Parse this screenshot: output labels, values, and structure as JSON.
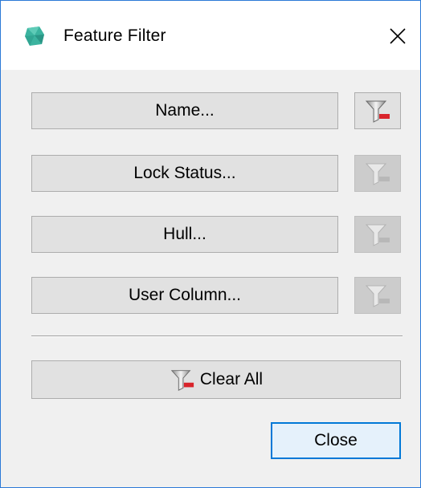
{
  "window": {
    "title": "Feature Filter"
  },
  "filters": [
    {
      "label": "Name...",
      "clear_enabled": true
    },
    {
      "label": "Lock Status...",
      "clear_enabled": false
    },
    {
      "label": "Hull...",
      "clear_enabled": false
    },
    {
      "label": "User Column...",
      "clear_enabled": false
    }
  ],
  "actions": {
    "clear_all_label": "Clear All",
    "close_label": "Close"
  },
  "icons": {
    "app": "hull-shape-icon",
    "filter_clear": "filter-clear-icon",
    "close": "close-icon"
  },
  "colors": {
    "accent": "#0078d7",
    "window_border": "#2b79d7",
    "app_icon": "#3bb39f",
    "filter_remove": "#d9242b"
  }
}
